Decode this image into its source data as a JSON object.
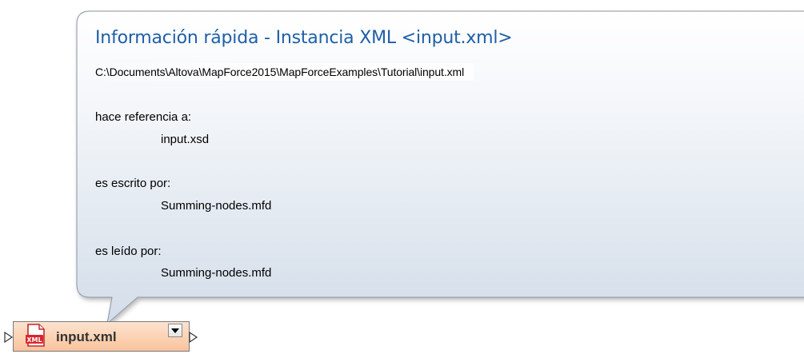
{
  "tooltip": {
    "title": "Información rápida - Instancia XML <input.xml>",
    "path": "C:\\Documents\\Altova\\MapForce2015\\MapForceExamples\\Tutorial\\input.xml",
    "sections": [
      {
        "label": "hace referencia a:",
        "value": "input.xsd"
      },
      {
        "label": "es escrito por:",
        "value": "Summing-nodes.mfd"
      },
      {
        "label": "es leído por:",
        "value": "Summing-nodes.mfd"
      }
    ]
  },
  "component": {
    "title": "input.xml",
    "icon": "xml-file-icon",
    "dropdown_icon": "chevron-down-icon",
    "icon_badge": "XML",
    "colors": {
      "header_top": "#fde3d0",
      "header_bottom": "#f8c39e",
      "icon_red": "#d9262c"
    }
  },
  "colors": {
    "title_blue": "#1e5fa8",
    "tooltip_bg_top": "#ffffff",
    "tooltip_bg_bottom": "#d4deea"
  }
}
